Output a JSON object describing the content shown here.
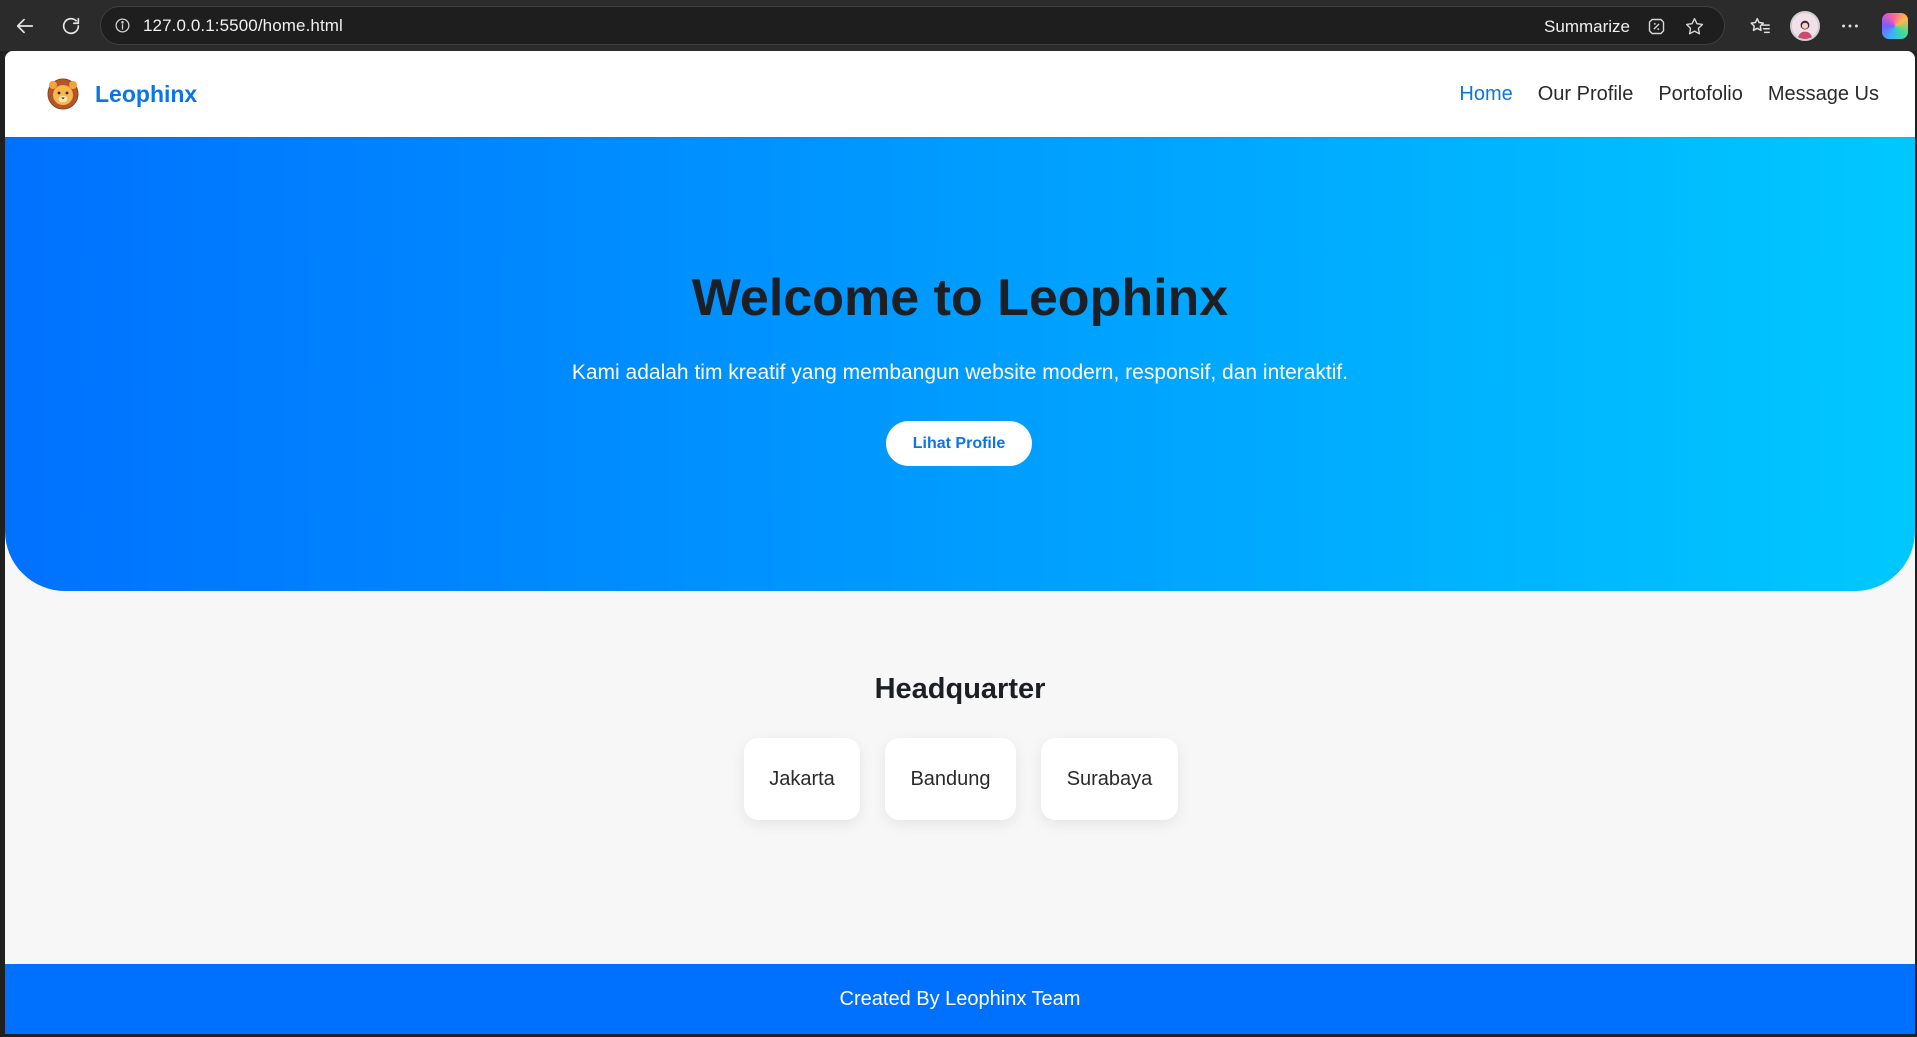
{
  "browser": {
    "url": "127.0.0.1:5500/home.html",
    "summarize_label": "Summarize",
    "icons": [
      "back-arrow-icon",
      "reload-icon",
      "site-info-icon",
      "summarize-icon",
      "favorite-star-icon",
      "favorites-icon",
      "profile-avatar",
      "more-options-icon",
      "copilot-icon"
    ]
  },
  "header": {
    "brand_name": "Leophinx",
    "logo_icon": "lion-icon",
    "nav": [
      {
        "label": "Home",
        "active": true
      },
      {
        "label": "Our Profile",
        "active": false
      },
      {
        "label": "Portofolio",
        "active": false
      },
      {
        "label": "Message Us",
        "active": false
      }
    ]
  },
  "hero": {
    "title": "Welcome to Leophinx",
    "subtitle": "Kami adalah tim kreatif yang membangun website modern, responsif, dan interaktif.",
    "button_label": "Lihat Profile"
  },
  "headquarter": {
    "title": "Headquarter",
    "cities": [
      "Jakarta",
      "Bandung",
      "Surabaya"
    ]
  },
  "footer": {
    "text": "Created By Leophinx Team"
  },
  "colors": {
    "accent": "#0b74e8",
    "hero_gradient_start": "#0071ff",
    "hero_gradient_end": "#00c8ff",
    "footer_bg": "#0071ff",
    "page_bg": "#f7f7f7"
  }
}
